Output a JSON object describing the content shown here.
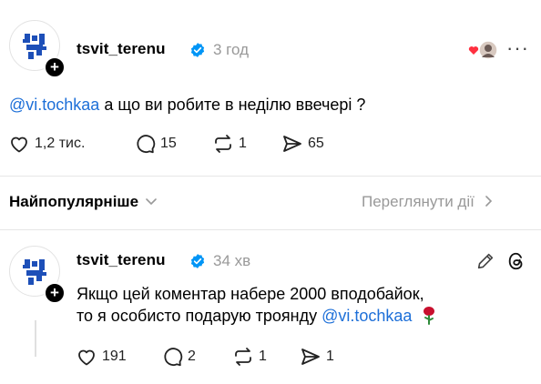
{
  "post": {
    "username": "tsvit_terenu",
    "time": "3 год",
    "mention": "@vi.tochkaa",
    "text": " а що ви робите в неділю ввечері ?",
    "likes": "1,2 тис.",
    "comments": "15",
    "reposts": "1",
    "shares": "65"
  },
  "sort": {
    "label": "Найпопулярніше",
    "activity_link": "Переглянути дії"
  },
  "reply": {
    "username": "tsvit_terenu",
    "time": "34 хв",
    "line1": "Якщо цей коментар набере 2000 вподобайок,",
    "line2_prefix": "то я особисто подарую троянду ",
    "mention": "@vi.tochkaa",
    "emoji": "🌹",
    "likes": "191",
    "comments": "2",
    "reposts": "1",
    "shares": "1"
  },
  "icons": {
    "verified": "verified-badge-icon",
    "heart": "heart-icon",
    "comment": "comment-icon",
    "repost": "repost-icon",
    "share": "share-icon",
    "more": "more-icon",
    "edit": "pencil-icon",
    "threads": "threads-logo-icon"
  },
  "colors": {
    "accent_blue": "#1d6fd8",
    "verified_blue": "#0095f6",
    "heart_red": "#ff3040"
  }
}
